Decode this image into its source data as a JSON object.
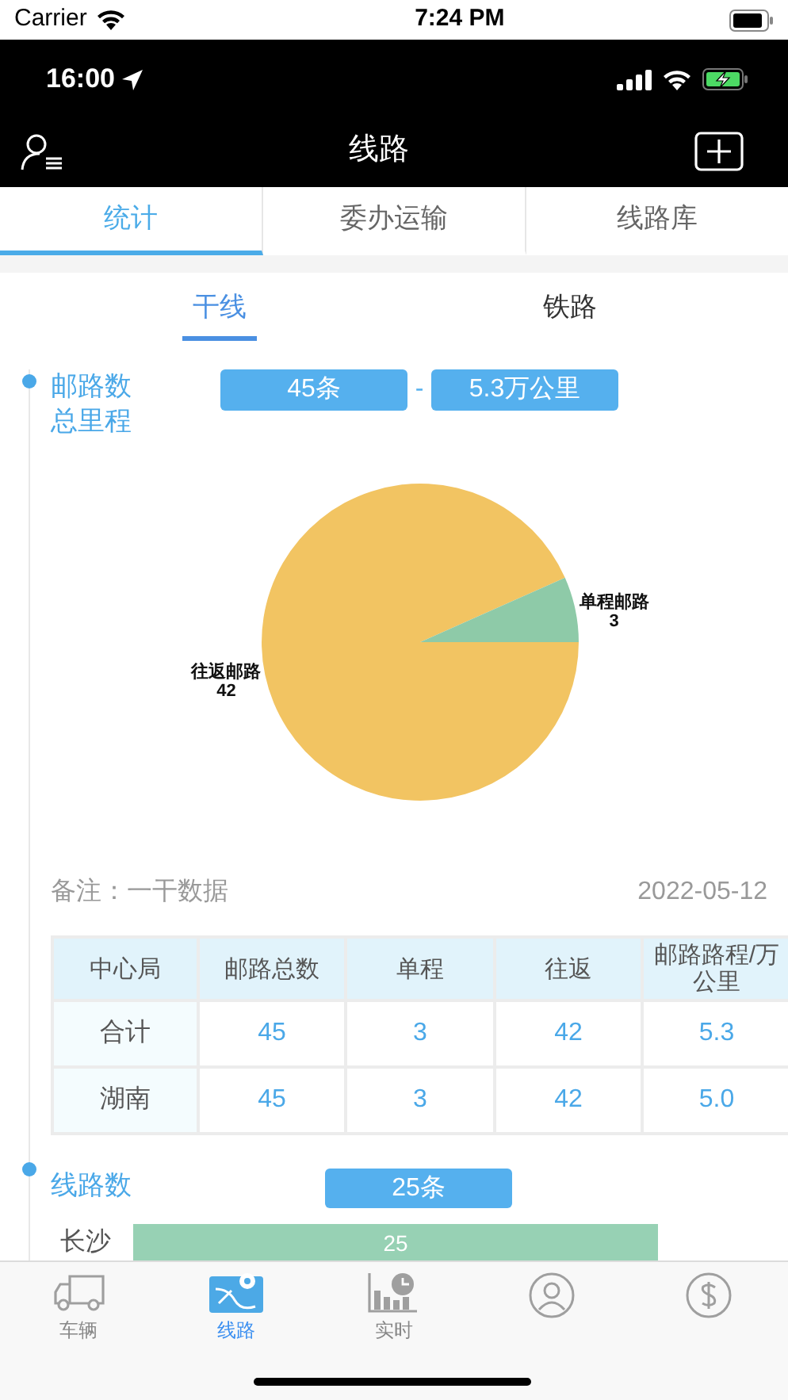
{
  "system_status": {
    "carrier": "Carrier",
    "time": "7:24 PM"
  },
  "app_status": {
    "time": "16:00"
  },
  "nav": {
    "title": "线路"
  },
  "tabs": [
    {
      "label": "统计",
      "selected": true
    },
    {
      "label": "委办运输",
      "selected": false
    },
    {
      "label": "线路库",
      "selected": false
    }
  ],
  "sub_tabs": [
    {
      "label": "干线",
      "selected": true
    },
    {
      "label": "铁路",
      "selected": false
    }
  ],
  "summary": {
    "label_lines": [
      "邮路数",
      "总里程"
    ],
    "count": "45条",
    "separator": "-",
    "distance": "5.3万公里"
  },
  "pie": {
    "chart_data": {
      "type": "pie",
      "categories": [
        "往返邮路",
        "单程邮路"
      ],
      "values": [
        42,
        3
      ],
      "value_labels": [
        "42",
        "3"
      ]
    }
  },
  "remark": {
    "note": "备注：一干数据",
    "date": "2022-05-12"
  },
  "table": {
    "columns": [
      "中心局",
      "邮路总数",
      "单程",
      "往返",
      "邮路路程/万公里"
    ],
    "rows": [
      {
        "cells": [
          "合计",
          "45",
          "3",
          "42",
          "5.3"
        ]
      },
      {
        "cells": [
          "湖南",
          "45",
          "3",
          "42",
          "5.0"
        ]
      }
    ]
  },
  "routes": {
    "label": "线路数",
    "count": "25条",
    "chart_data": {
      "type": "bar",
      "orientation": "horizontal",
      "categories": [
        "长沙"
      ],
      "values": [
        25
      ],
      "value_labels": [
        "25"
      ]
    }
  },
  "bottom_tabs": [
    {
      "kind": "truck",
      "label": "车辆",
      "selected": false
    },
    {
      "kind": "route",
      "label": "线路",
      "selected": true
    },
    {
      "kind": "realtime",
      "label": "实时",
      "selected": false
    },
    {
      "kind": "person",
      "selected": false
    },
    {
      "kind": "dollar",
      "selected": false
    }
  ]
}
